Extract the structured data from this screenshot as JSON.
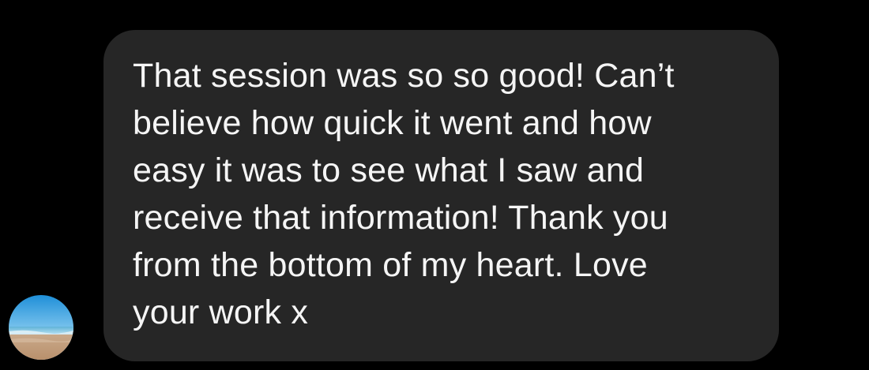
{
  "message": {
    "lines": [
      "That session was so so good! Can’t",
      "believe how quick it went and how",
      "easy it was to see what I saw and",
      "receive that information! Thank you",
      "from the bottom of my heart. Love",
      "your work x"
    ]
  },
  "avatar": {
    "icon": "beach-photo-avatar"
  },
  "colors": {
    "background": "#000000",
    "bubble": "#262626",
    "text": "#f5f5f5"
  }
}
